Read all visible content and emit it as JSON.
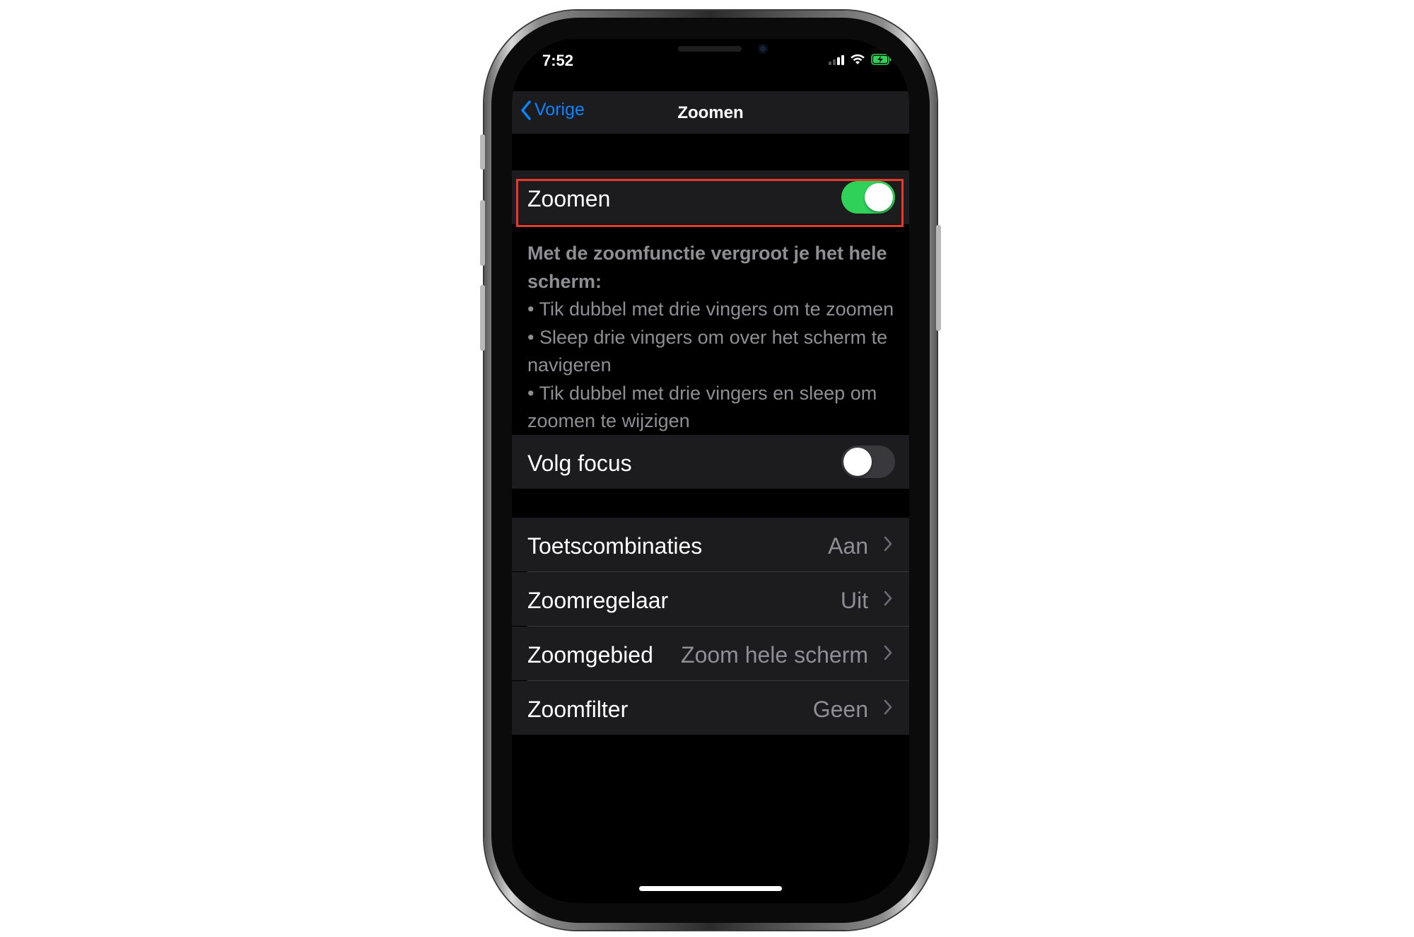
{
  "status_bar": {
    "time": "7:52",
    "signal_bars": 4,
    "signal_bars_filled": 2,
    "battery_charging": true,
    "battery_color": "#30d158"
  },
  "nav": {
    "back_label": "Vorige",
    "title": "Zoomen"
  },
  "zoom_toggle": {
    "label": "Zoomen",
    "on": true
  },
  "description": {
    "heading": "Met de zoomfunctie vergroot je het hele scherm:",
    "bullets": [
      "• Tik dubbel met drie vingers om te zoomen",
      "• Sleep drie vingers om over het scherm te navigeren",
      "• Tik dubbel met drie vingers en sleep om zoomen te wijzigen"
    ]
  },
  "follow_focus": {
    "label": "Volg focus",
    "on": false
  },
  "settings_list": [
    {
      "label": "Toetscombinaties",
      "value": "Aan"
    },
    {
      "label": "Zoomregelaar",
      "value": "Uit"
    },
    {
      "label": "Zoomgebied",
      "value": "Zoom hele scherm"
    },
    {
      "label": "Zoomfilter",
      "value": "Geen"
    }
  ],
  "colors": {
    "accent": "#0a84ff",
    "toggle_on": "#30d158",
    "highlight": "#e53b2a",
    "cell_bg": "#1c1c1e"
  }
}
